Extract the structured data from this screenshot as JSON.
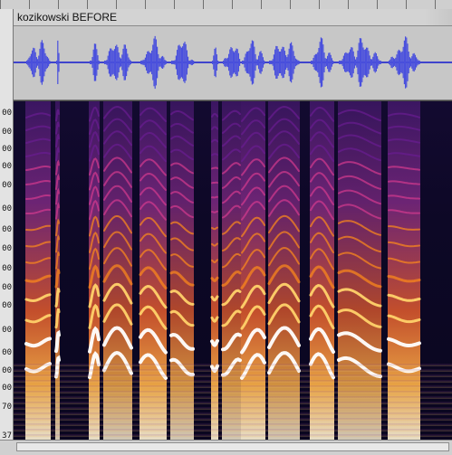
{
  "track": {
    "title": "kozikowski BEFORE"
  },
  "frequency_axis": {
    "tick_labels": [
      "00",
      "00",
      "00",
      "00",
      "00",
      "00",
      "00",
      "00",
      "00",
      "00",
      "00",
      "00",
      "00",
      "00",
      "00",
      "70",
      "37"
    ]
  },
  "colors": {
    "waveform_fill": "#4a50dd",
    "waveform_background": "#c7c7c7",
    "spectrogram_background": "#0b0722",
    "harmonic_bright": "#ffffff",
    "harmonic_yellow": "#ffd26a",
    "harmonic_orange": "#ff8c1a",
    "harmonic_magenta": "#d53b8f",
    "harmonic_purple": "#6a1d91"
  },
  "icons": {
    "scroll_thumb": "horizontal-scrollbar"
  }
}
